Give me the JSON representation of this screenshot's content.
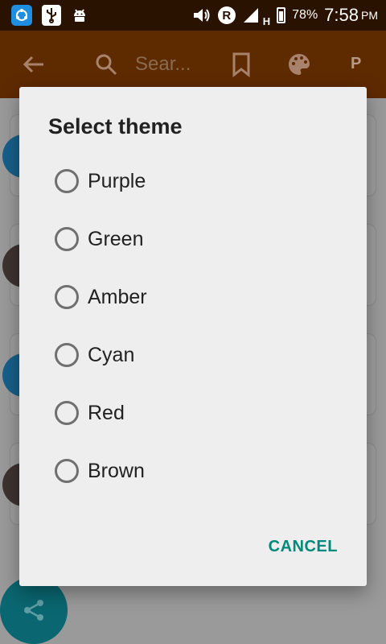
{
  "status_bar": {
    "battery": "78%",
    "time": "7:58",
    "ampm": "PM",
    "roaming": "R",
    "network": "H"
  },
  "toolbar": {
    "search_placeholder": "Sear...",
    "profile_initial": "P"
  },
  "dialog": {
    "title": "Select theme",
    "options": [
      "Purple",
      "Green",
      "Amber",
      "Cyan",
      "Red",
      "Brown"
    ],
    "cancel_label": "CANCEL",
    "accent_color": "#00897b"
  },
  "colors": {
    "status_bar": "#2a1200",
    "toolbar": "#5e2a00",
    "scrim": "#9a9a9a",
    "fab": "#0a6670"
  }
}
